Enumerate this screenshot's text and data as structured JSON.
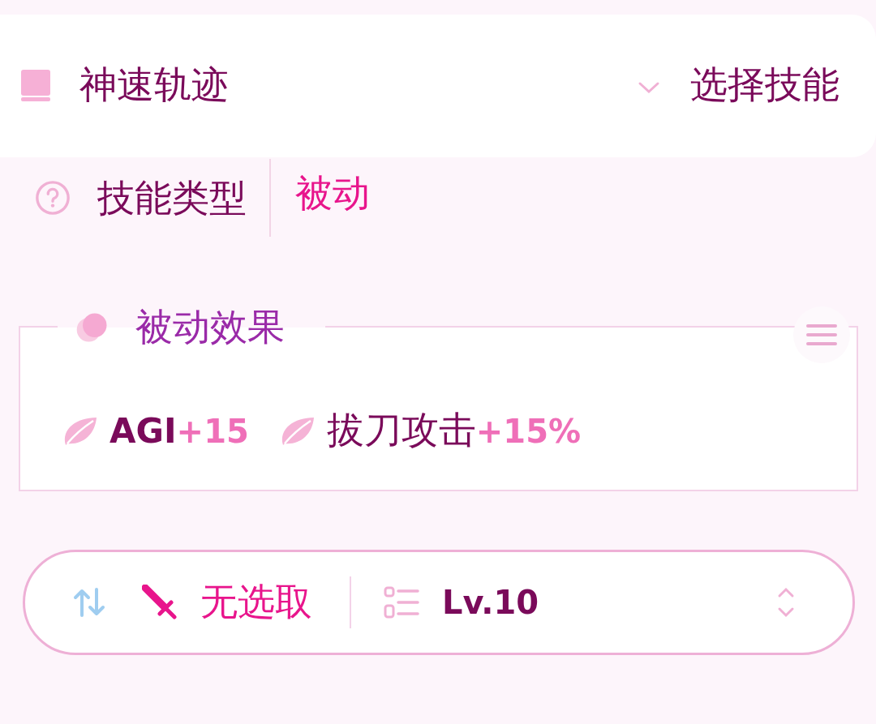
{
  "skill_select": {
    "name": "神速轨迹",
    "action": "选择技能"
  },
  "skill_type": {
    "label": "技能类型",
    "value": "被动"
  },
  "passive_effects": {
    "title": "被动效果",
    "effects": [
      {
        "name": "AGI",
        "bonus": "+15",
        "kind": "latin"
      },
      {
        "name": "拔刀攻击",
        "bonus": "+15%",
        "kind": "cjk"
      }
    ]
  },
  "bottom_bar": {
    "target": "无选取",
    "level": "Lv.10"
  }
}
